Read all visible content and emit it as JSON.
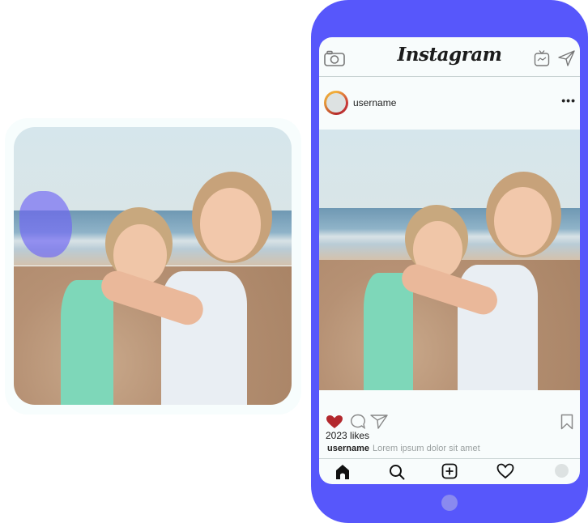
{
  "original_photo": {
    "description": "two children hugging on beach",
    "highlight_region": "people-in-background"
  },
  "phone": {
    "app": {
      "logo": "Instagram",
      "top_icons": [
        "camera-icon",
        "igtv-icon",
        "direct-message-icon"
      ]
    },
    "post": {
      "username": "username",
      "more_label": "•••",
      "likes": "2023 likes",
      "caption_user": "username",
      "caption_text": "Lorem ipsum dolor sit amet",
      "liked": true,
      "action_icons": [
        "heart-icon",
        "comment-icon",
        "share-icon",
        "bookmark-icon"
      ]
    },
    "bottom_nav": [
      "home",
      "search",
      "add-post",
      "activity",
      "profile"
    ]
  },
  "colors": {
    "phone_body": "#5757fb",
    "highlight": "#6e64f5",
    "liked_heart": "#b3282d"
  }
}
